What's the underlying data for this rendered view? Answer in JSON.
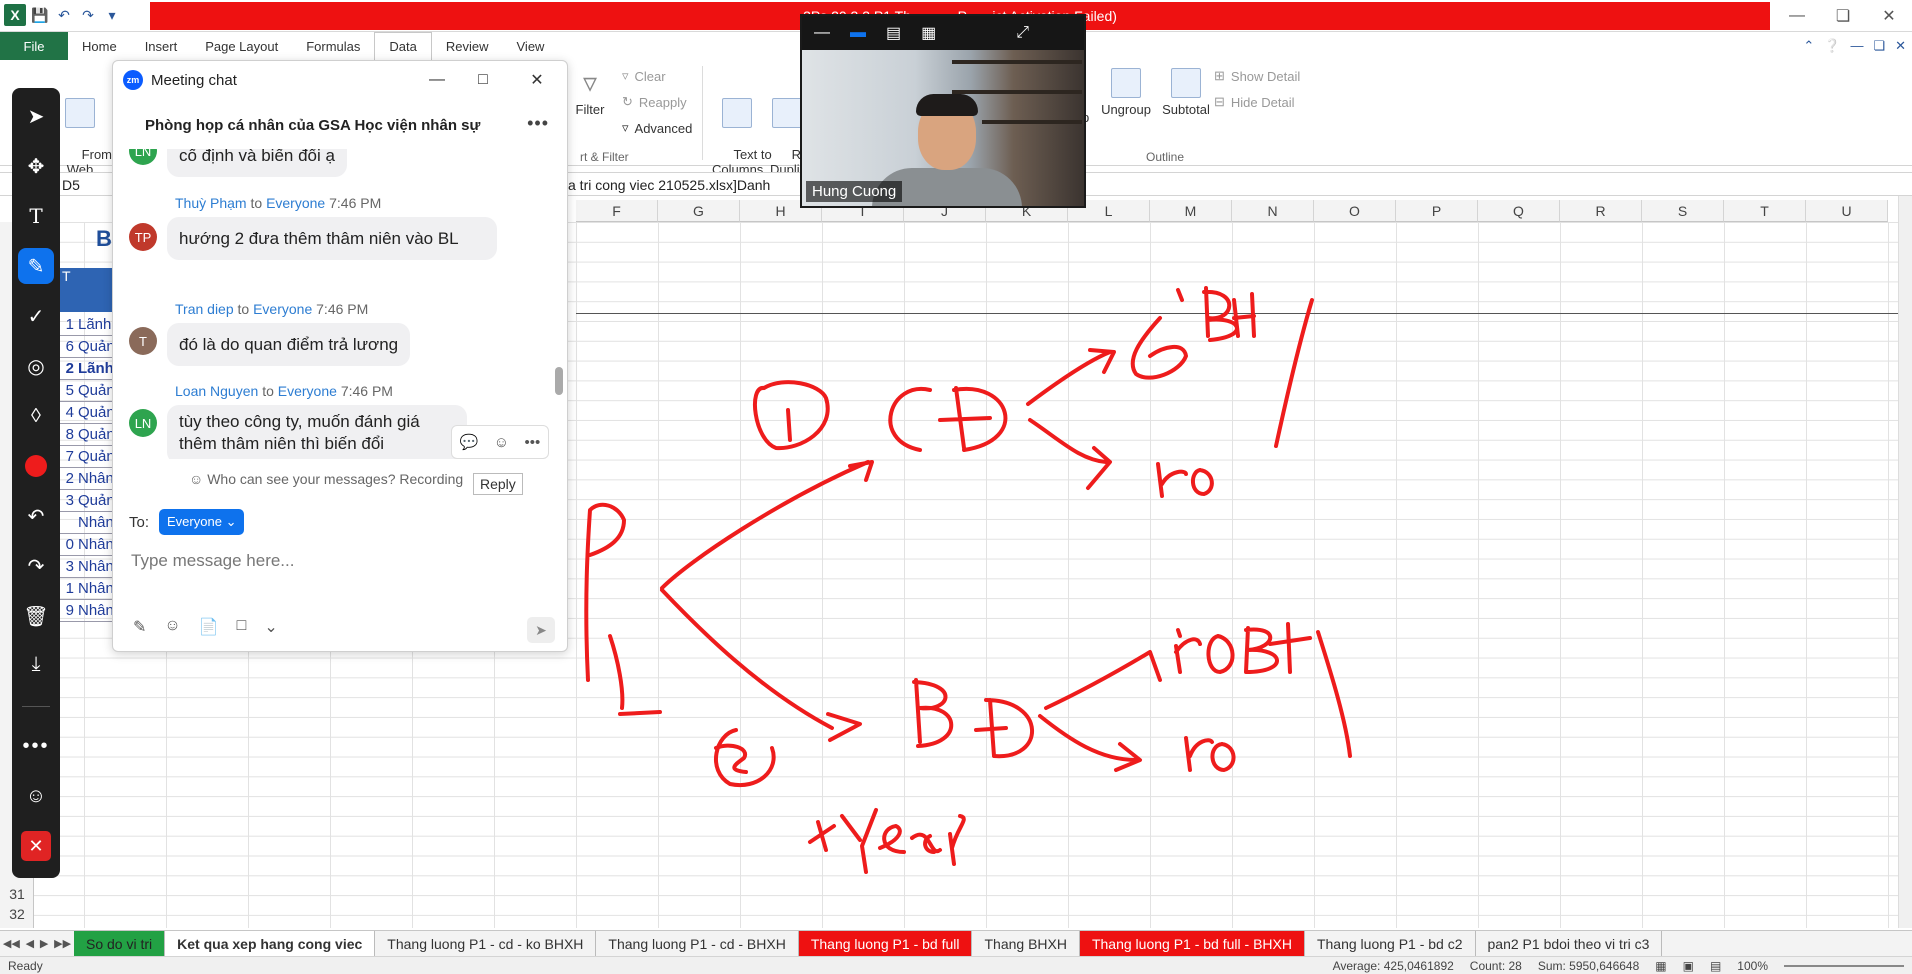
{
  "titlebar": {
    "title": "3Ps 20 3.3 P1 Th... ... ... P... ...ict Activation Failed)",
    "file_icon": "X"
  },
  "ribbon_tabs": [
    "File",
    "Home",
    "Insert",
    "Page Layout",
    "Formulas",
    "Data",
    "Review",
    "View"
  ],
  "active_tab": "Data",
  "ribbon": {
    "from_web": "From\nWeb",
    "filter": "Filter",
    "clear": "Clear",
    "reapply": "Reapply",
    "advanced": "Advanced",
    "sort_filter_label": "rt & Filter",
    "text_to_columns": "Text to\nColumns",
    "remove_dup": "Rem\nDuplic",
    "ungroup": "Ungroup",
    "subtotal": "Subtotal",
    "show_detail": "Show Detail",
    "hide_detail": "Hide Detail",
    "outline_label": "Outline",
    "partial_p": "p"
  },
  "formula_bar": {
    "name_box": "D5",
    "formula": "a tri cong viec 210525.xlsx]Danh"
  },
  "columns": [
    "F",
    "G",
    "H",
    "I",
    "J",
    "K",
    "L",
    "M",
    "N",
    "O",
    "P",
    "Q",
    "R",
    "S",
    "T",
    "U"
  ],
  "rows_bottom": [
    "31",
    "32"
  ],
  "left_cells": {
    "header_letter": "B",
    "header_t": "T",
    "items": [
      {
        "n": "1",
        "text": "Lãnh",
        "bold": false
      },
      {
        "n": "6",
        "text": "Quản",
        "bold": false
      },
      {
        "n": "2",
        "text": "Lãnh",
        "bold": true
      },
      {
        "n": "5",
        "text": "Quản",
        "bold": false
      },
      {
        "n": "4",
        "text": "Quản",
        "bold": false
      },
      {
        "n": "8",
        "text": "Quản",
        "bold": false
      },
      {
        "n": "7",
        "text": "Quản",
        "bold": false
      },
      {
        "n": "2",
        "text": "Nhân",
        "bold": false
      },
      {
        "n": "3",
        "text": "Quản",
        "bold": false
      },
      {
        "n": "",
        "text": "Nhân",
        "bold": false
      },
      {
        "n": "0",
        "text": "Nhân",
        "bold": false
      },
      {
        "n": "3",
        "text": "Nhân",
        "bold": false
      },
      {
        "n": "1",
        "text": "Nhân",
        "bold": false
      },
      {
        "n": "9",
        "text": "Nhân",
        "bold": false
      }
    ]
  },
  "sheet_tabs": [
    {
      "label": "So do vi tri",
      "style": "green"
    },
    {
      "label": "Ket qua xep hang cong viec",
      "style": "active"
    },
    {
      "label": "Thang luong P1 - cd - ko BHXH",
      "style": "normal"
    },
    {
      "label": "Thang luong P1 - cd - BHXH",
      "style": "normal"
    },
    {
      "label": "Thang luong P1 - bd full",
      "style": "red"
    },
    {
      "label": "Thang BHXH",
      "style": "normal"
    },
    {
      "label": "Thang luong P1 - bd full - BHXH",
      "style": "red"
    },
    {
      "label": "Thang luong P1 - bd c2",
      "style": "normal"
    },
    {
      "label": "pan2 P1 bdoi theo vi tri c3",
      "style": "normal"
    }
  ],
  "statusbar": {
    "ready": "Ready",
    "average": "Average: 425,0461892",
    "count": "Count: 28",
    "sum": "Sum: 5950,646648",
    "zoom": "100%"
  },
  "chat": {
    "title": "Meeting chat",
    "logo": "zm",
    "room": "Phòng họp cá nhân của GSA Học viện nhân sự",
    "messages": [
      {
        "initials": "LN",
        "color": "#2ea44f",
        "sender": "",
        "to": "",
        "time": "",
        "text": "cố định và biến đổi ạ"
      },
      {
        "initials": "TP",
        "color": "#c0392b",
        "sender": "Thuỳ Phạm",
        "to": "Everyone",
        "time": "7:46 PM",
        "text": "hướng 2 đưa thêm thâm niên vào BL"
      },
      {
        "initials": "T",
        "color": "#8a6a5a",
        "sender": "Tran diep",
        "to": "Everyone",
        "time": "7:46 PM",
        "text": "đó là do quan điểm trả lương"
      },
      {
        "initials": "LN",
        "color": "#2ea44f",
        "sender": "Loan Nguyen",
        "to": "Everyone",
        "time": "7:46 PM",
        "text": "tùy theo công ty, muốn đánh giá thêm thâm niên thì biến đổi"
      }
    ],
    "to_word": "to",
    "who_can_see": "Who can see your messages? Recording",
    "reply_tip": "Reply",
    "to_label": "To:",
    "to_value": "Everyone",
    "placeholder": "Type message here..."
  },
  "video": {
    "name": "Hung Cuong"
  },
  "annotation_tools": [
    "select-icon",
    "move-icon",
    "text-icon",
    "pen-icon",
    "stamp-icon",
    "spotlight-icon",
    "eraser-icon",
    "color-icon",
    "undo-icon",
    "redo-icon",
    "delete-icon",
    "save-icon",
    "more-icon",
    "participant-icon",
    "close-icon"
  ],
  "ink": {
    "color": "#ee1c1c",
    "labels": [
      "1",
      "CĐ",
      "có BH",
      "Ko",
      "1",
      "BĐ",
      "có BH",
      "Ko",
      "2",
      "+Year"
    ]
  }
}
